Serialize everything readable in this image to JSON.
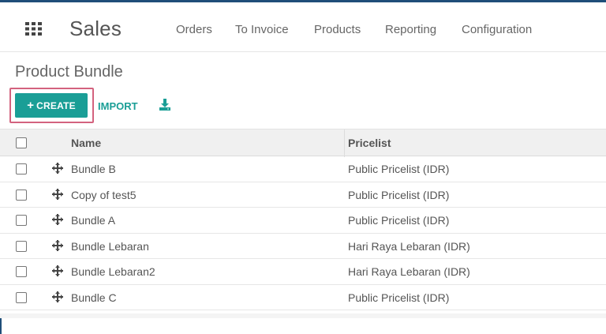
{
  "navbar": {
    "apps_icon": "grid-icon",
    "app_name": "Sales",
    "menu": [
      "Orders",
      "To Invoice",
      "Products",
      "Reporting",
      "Configuration"
    ]
  },
  "page": {
    "title": "Product Bundle"
  },
  "toolbar": {
    "create_label": "CREATE",
    "create_icon": "+",
    "import_label": "IMPORT",
    "download_icon": "download-icon"
  },
  "table": {
    "columns": [
      "Name",
      "Pricelist"
    ],
    "rows": [
      {
        "name": "Bundle B",
        "pricelist": "Public Pricelist (IDR)"
      },
      {
        "name": "Copy of test5",
        "pricelist": "Public Pricelist (IDR)"
      },
      {
        "name": "Bundle A",
        "pricelist": "Public Pricelist (IDR)"
      },
      {
        "name": "Bundle Lebaran",
        "pricelist": "Hari Raya Lebaran (IDR)"
      },
      {
        "name": "Bundle Lebaran2",
        "pricelist": "Hari Raya Lebaran (IDR)"
      },
      {
        "name": "Bundle C",
        "pricelist": "Public Pricelist (IDR)"
      }
    ]
  },
  "colors": {
    "accent": "#1a9e96",
    "highlight": "#d3627e",
    "frame": "#1f4e79"
  }
}
